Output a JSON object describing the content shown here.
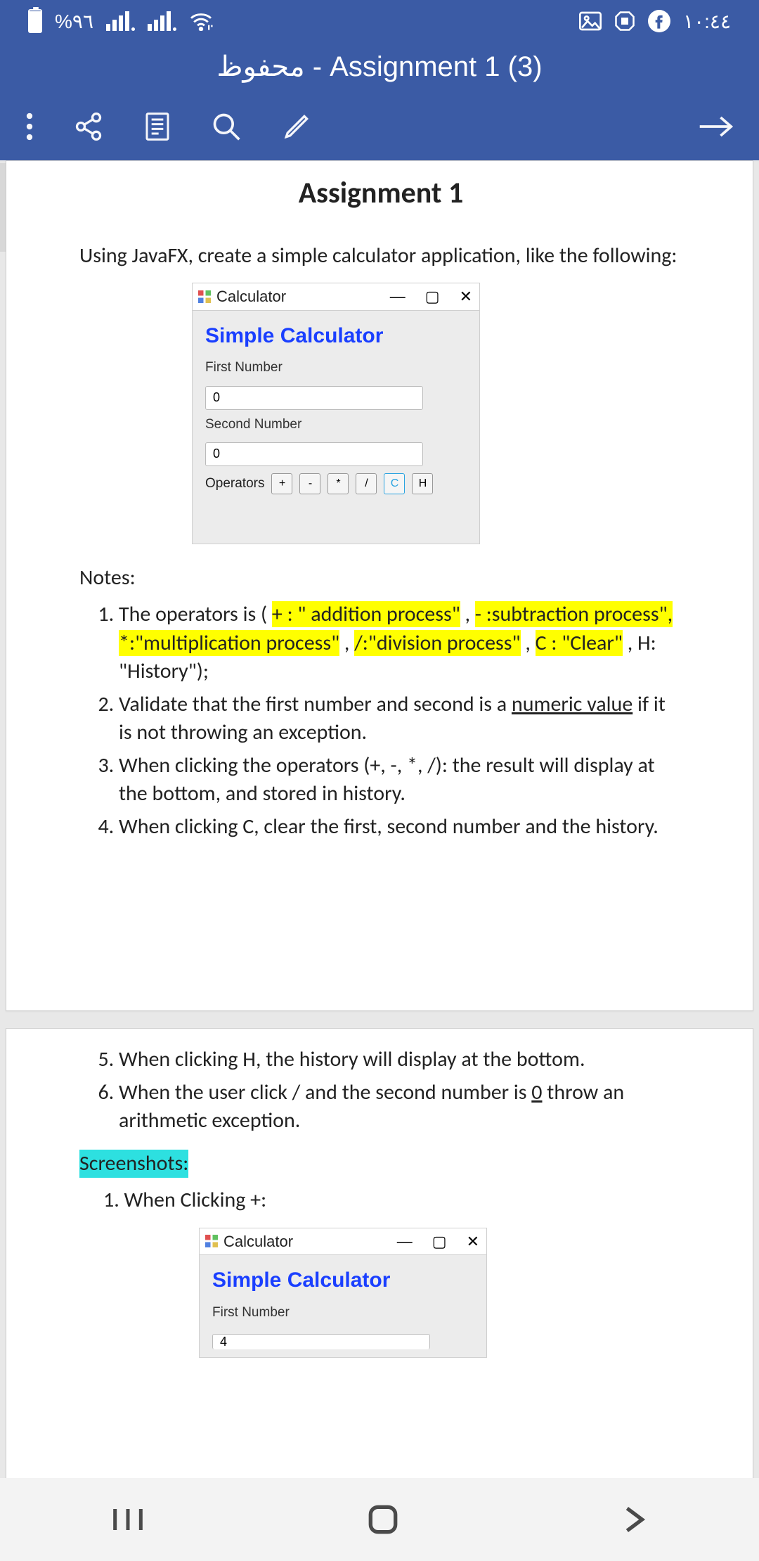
{
  "status": {
    "battery_pct": "%٩٦",
    "time": "١٠:٤٤"
  },
  "header": {
    "title": "محفوظ - Assignment 1 (3)"
  },
  "doc": {
    "heading": "Assignment 1",
    "intro": "Using JavaFX, create a simple calculator application, like the following:",
    "notes_label": "Notes:",
    "screenshots_label": "Screenshots:",
    "shot_item": "1. When Clicking +:",
    "n1_pre": "The operators is ( ",
    "n1_hl1": "+ : \" addition process\"",
    "n1_mid1": " , ",
    "n1_hl2": "- :subtraction process\", *:\"multiplication process\"",
    "n1_mid2": " , ",
    "n1_hl3": "/:\"division process\"",
    "n1_mid3": " , ",
    "n1_hl4": "C : \"Clear\"",
    "n1_mid4": " , H: \"History\");",
    "n2_a": "Validate that the first number and second is a ",
    "n2_u": "numeric value",
    "n2_b": " if it is not throwing an exception.",
    "n3": "When clicking the operators (+, -, *, /): the result will display at the bottom, and stored in history.",
    "n4": "When clicking C, clear the first, second number and the history.",
    "n5": "When clicking H, the history will display at the bottom.",
    "n6_a": "When the user click / and the second number is ",
    "n6_u": "0",
    "n6_b": " throw an arithmetic exception."
  },
  "calc": {
    "win_title": "Calculator",
    "heading": "Simple Calculator",
    "first_label": "First Number",
    "second_label": "Second Number",
    "operators_label": "Operators",
    "first_val": "0",
    "second_val": "0",
    "first_val2": "4",
    "btn_plus": "+",
    "btn_minus": "-",
    "btn_mul": "*",
    "btn_div": "/",
    "btn_c": "C",
    "btn_h": "H"
  }
}
